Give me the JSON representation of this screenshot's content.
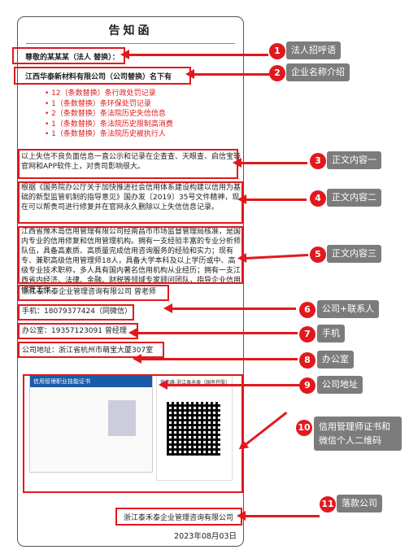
{
  "doc": {
    "title": "告知函",
    "greeting": "尊敬的某某某（法人 替换）：",
    "company_line": "江西华泰新材料有限公司（公司替换）名下有",
    "records": [
      "12（条数替换）条行政处罚记录",
      "1（条数替换）条环保处罚记录",
      "2（条数替换）条法院历史失信信息",
      "1（条数替换）条法院历史限制高消费",
      "1（条数替换）条法院历史被执行人"
    ],
    "para1": "以上失信不良负面信息一直公示和记录在企查查、天眼查、启信宝等官网和APP软件上，对贵司影响很大。",
    "para2": "根据《国务院办公厅关于加快推进社会信用体系建设构建以信用为基础的新型监管机制的指导意见》国办发〔2019〕35号文件精神，现在可以帮贵司进行修复并在官网永久删除以上失信信息记录。",
    "para3": "江西省豫木岛信用管理有限公司经南昌市市场监督管理局核准，是国内专业的信用修复和信用管理机构。拥有一支经验丰富的专业分析师队伍，具备高素质、高质量完成信用咨询服务的经验和实力；现有专、兼职高级信用管理师18人，具备大学本科及以上学历或中、高级专业技术职称，多人具有国内著名信用机构从业经历；拥有一支江西省内经济、法律、金融、财税等领域专家顾问团队，指导企业信用修复工作。",
    "contact": "浙江泰禾泰企业管理咨询有限公司 曾老师",
    "phone": "手机：18079377424（同微信）",
    "office": "办公室：19357123091 曾经理",
    "address": "公司地址：浙江省杭州市萌宝大厦307室",
    "cert_title": "信用管理职业技能证书",
    "wechat_name": "曾伟峰-浙江泰禾泰（国有控股）",
    "signature": "浙江泰禾泰企业管理咨询有限公司",
    "date": "2023年08月03日"
  },
  "annotations": [
    {
      "num": "1",
      "label": "法人招呼语"
    },
    {
      "num": "2",
      "label": "企业名称介绍"
    },
    {
      "num": "3",
      "label": "正文内容一"
    },
    {
      "num": "4",
      "label": "正文内容二"
    },
    {
      "num": "5",
      "label": "正文内容三"
    },
    {
      "num": "6",
      "label": "公司+联系人"
    },
    {
      "num": "7",
      "label": "手机"
    },
    {
      "num": "8",
      "label": "办公室"
    },
    {
      "num": "9",
      "label": "公司地址"
    },
    {
      "num": "10",
      "label": "信用管理师证书和微信个人二维码"
    },
    {
      "num": "11",
      "label": "落款公司"
    }
  ],
  "colors": {
    "accent": "#e1191d",
    "tag_bg": "#7c7c7c"
  }
}
